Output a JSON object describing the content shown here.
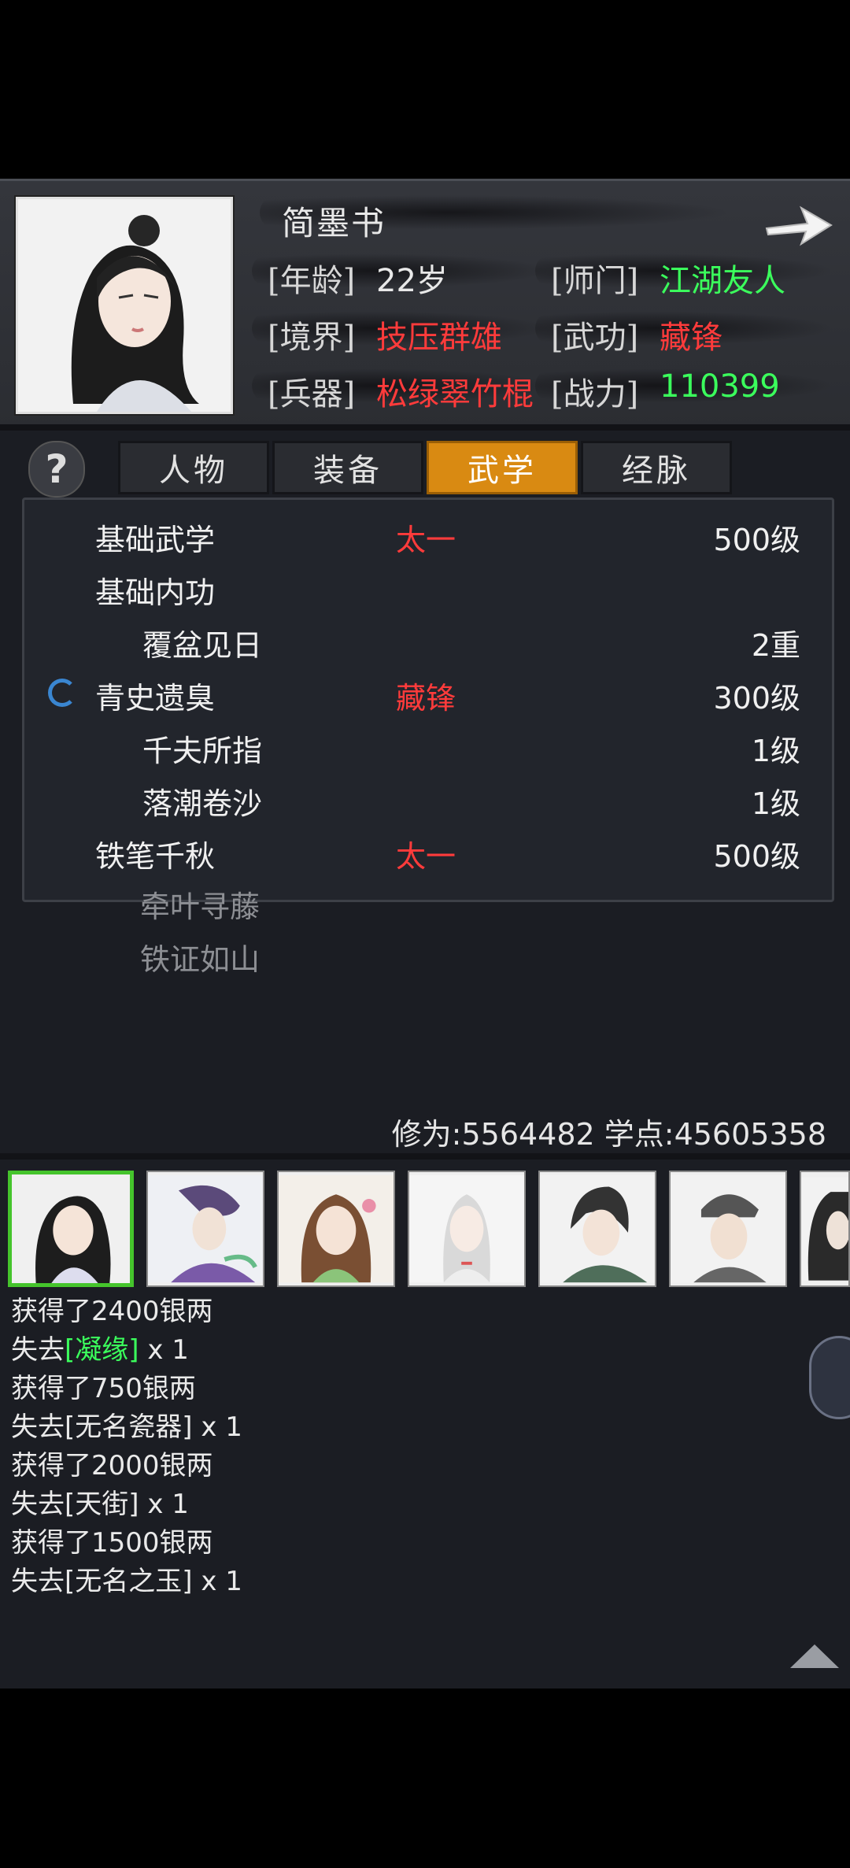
{
  "character": {
    "name": "简墨书",
    "rows": [
      {
        "label": "[年龄]",
        "value": "22岁",
        "label2": "[师门]",
        "value2": "江湖友人"
      },
      {
        "label": "[境界]",
        "value": "技压群雄",
        "label2": "[武功]",
        "value2": "藏锋"
      },
      {
        "label": "[兵器]",
        "value": "松绿翠竹棍",
        "label2": "[战力]",
        "value2": "110399"
      }
    ]
  },
  "help_label": "?",
  "tabs": [
    {
      "label": "人物",
      "active": false
    },
    {
      "label": "装备",
      "active": false
    },
    {
      "label": "武学",
      "active": true
    },
    {
      "label": "经脉",
      "active": false
    }
  ],
  "skills": [
    {
      "name": "基础武学",
      "tag": "太一",
      "level": "500级"
    },
    {
      "name": "基础内功",
      "tag": "",
      "level": ""
    },
    {
      "name": "覆盆见日",
      "tag": "",
      "level": "2重"
    },
    {
      "name": "青史遗臭",
      "tag": "藏锋",
      "level": "300级"
    },
    {
      "name": "千夫所指",
      "tag": "",
      "level": "1级"
    },
    {
      "name": "落潮卷沙",
      "tag": "",
      "level": "1级"
    },
    {
      "name": "铁笔千秋",
      "tag": "太一",
      "level": "500级"
    },
    {
      "name": "牵叶寻藤",
      "tag": "",
      "level": ""
    },
    {
      "name": "铁证如山",
      "tag": "",
      "level": ""
    }
  ],
  "stats": {
    "text": "修为:5564482  学点:45605358"
  },
  "log": [
    {
      "pre": "获得了2400银两",
      "hl": "",
      "post": ""
    },
    {
      "pre": "失去",
      "hl": "[凝缘]",
      "post": " x 1"
    },
    {
      "pre": "获得了750银两",
      "hl": "",
      "post": ""
    },
    {
      "pre": "失去[无名瓷器] x 1",
      "hl": "",
      "post": ""
    },
    {
      "pre": "获得了2000银两",
      "hl": "",
      "post": ""
    },
    {
      "pre": "失去[天街] x 1",
      "hl": "",
      "post": ""
    },
    {
      "pre": "获得了1500银两",
      "hl": "",
      "post": ""
    },
    {
      "pre": "失去[无名之玉] x 1",
      "hl": "",
      "post": ""
    }
  ],
  "colors": {
    "accent": "#d98a12",
    "red": "#ff3b3b",
    "green": "#3bff5c",
    "selected_border": "#45c42c"
  }
}
